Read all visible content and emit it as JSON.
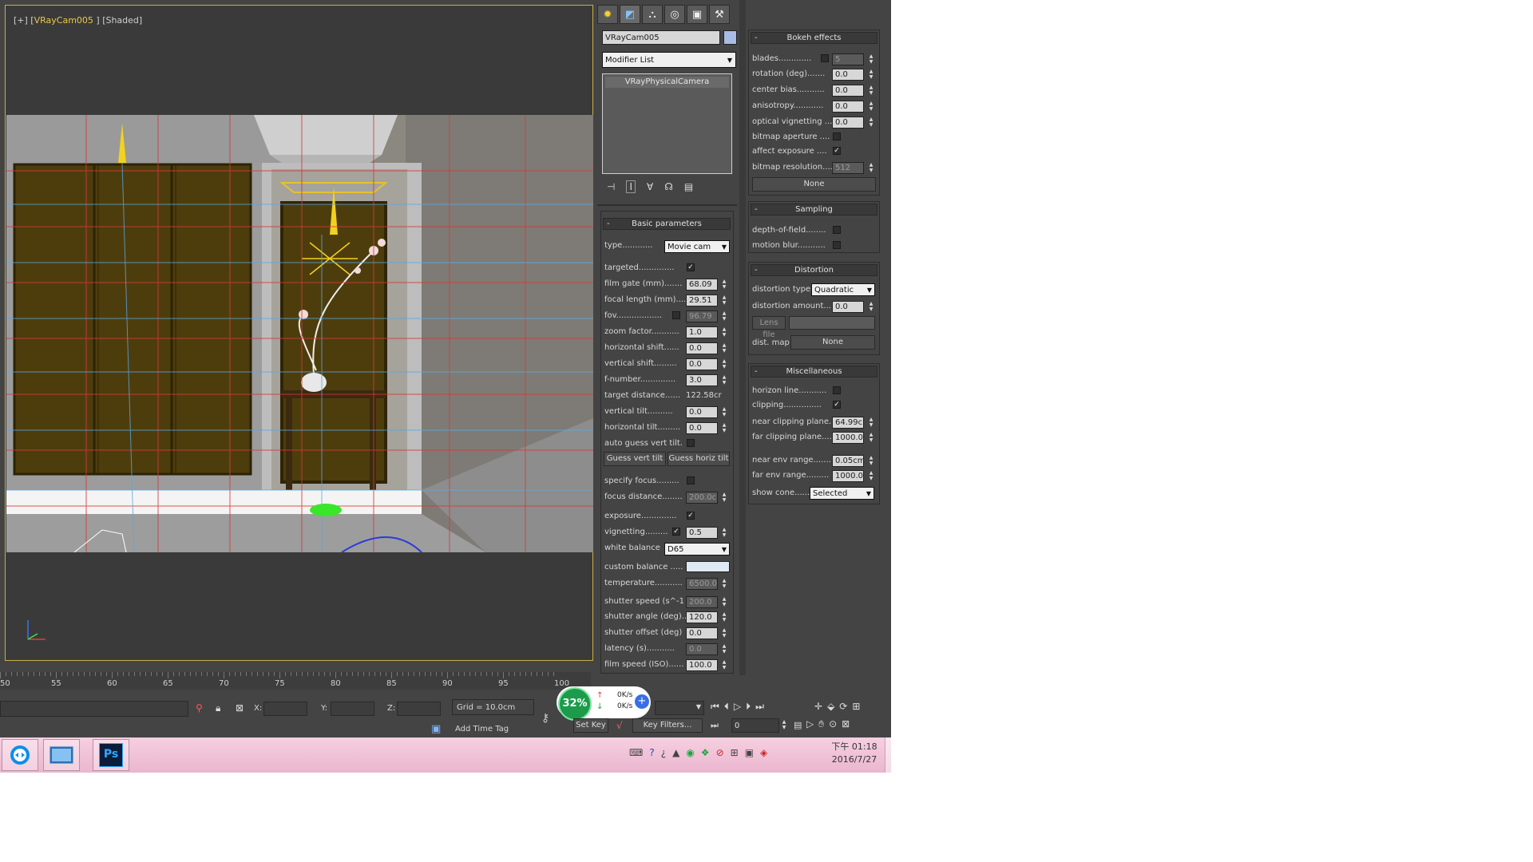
{
  "viewport": {
    "label_prefix": "[+] [",
    "camera": "VRayCam005",
    "label_suffix": " ] [Shaded]"
  },
  "command_panel": {
    "tabs": [
      "create-icon",
      "modify-icon",
      "hierarchy-icon",
      "motion-icon",
      "display-icon",
      "utilities-icon"
    ],
    "object_name": "VRayCam005",
    "object_color": "#a8bce6",
    "modifier_list": "Modifier List",
    "stack_item": "VRayPhysicalCamera"
  },
  "basic": {
    "title": "Basic parameters",
    "type_label": "type............",
    "type_value": "Movie cam",
    "targeted": "targeted..............",
    "film_gate": "film gate (mm).......",
    "film_gate_v": "68.09",
    "focal_length": "focal length (mm)....",
    "focal_length_v": "29.51",
    "fov": "fov..................",
    "fov_v": "96.79",
    "zoom": "zoom factor...........",
    "zoom_v": "1.0",
    "hshift": "horizontal shift......",
    "hshift_v": "0.0",
    "vshift": "vertical shift.........",
    "vshift_v": "0.0",
    "fnumber": "f-number..............",
    "fnumber_v": "3.0",
    "target_distance": "target distance......",
    "target_distance_v": "122.58cr",
    "vtilt": "vertical tilt..........",
    "vtilt_v": "0.0",
    "htilt": "horizontal tilt.........",
    "htilt_v": "0.0",
    "auto_guess": "auto guess vert tilt.",
    "guess_vert": "Guess vert tilt",
    "guess_horiz": "Guess horiz tilt",
    "specify_focus": "specify focus.........",
    "focus_distance": "focus distance........",
    "focus_distance_v": "200.0cr",
    "exposure": "exposure..............",
    "vignetting": "vignetting.........",
    "vignetting_v": "0.5",
    "white_balance": "white balance",
    "white_balance_v": "D65",
    "custom_balance": "custom balance .....",
    "custom_balance_color": "#dfe8f5",
    "temperature": "temperature...........",
    "temperature_v": "6500.0",
    "shutter_speed": "shutter speed (s^-1",
    "shutter_speed_v": "200.0",
    "shutter_angle": "shutter angle (deg)..",
    "shutter_angle_v": "120.0",
    "shutter_offset": "shutter offset (deg)",
    "shutter_offset_v": "0.0",
    "latency": "latency (s)...........",
    "latency_v": "0.0",
    "film_speed": "film speed (ISO)......",
    "film_speed_v": "100.0"
  },
  "bokeh": {
    "title": "Bokeh effects",
    "blades": "blades.............",
    "blades_v": "5",
    "rotation": "rotation (deg).......",
    "rotation_v": "0.0",
    "center_bias": "center bias...........",
    "center_bias_v": "0.0",
    "anisotropy": "anisotropy............",
    "anisotropy_v": "0.0",
    "optical": "optical vignetting ...",
    "optical_v": "0.0",
    "bitmap_aperture": "bitmap aperture ....",
    "affect_exposure": "affect exposure ....",
    "bitmap_res": "bitmap resolution....",
    "bitmap_res_v": "512",
    "none": "None"
  },
  "sampling": {
    "title": "Sampling",
    "dof": "depth-of-field........",
    "motion_blur": "motion blur..........."
  },
  "distortion": {
    "title": "Distortion",
    "type": "distortion type.",
    "type_v": "Quadratic",
    "amount": "distortion amount...",
    "amount_v": "0.0",
    "lens_file": "Lens file",
    "dist_map": "dist. map",
    "none": "None"
  },
  "misc": {
    "title": "Miscellaneous",
    "horizon": "horizon line...........",
    "clipping": "clipping...............",
    "near_clip": "near clipping plane..",
    "near_clip_v": "64.99cr",
    "far_clip": "far clipping plane....",
    "far_clip_v": "1000.0",
    "near_env": "near env range.......",
    "near_env_v": "0.05cm",
    "far_env": "far env range.........",
    "far_env_v": "1000.0",
    "show_cone": "show cone......",
    "show_cone_v": "Selected"
  },
  "timeline": {
    "ticks": [
      "50",
      "55",
      "60",
      "65",
      "70",
      "75",
      "80",
      "85",
      "90",
      "95",
      "100"
    ]
  },
  "status": {
    "x_label": "X:",
    "y_label": "Y:",
    "z_label": "Z:",
    "grid": "Grid = 10.0cm",
    "add_time_tag": "Add Time Tag",
    "set_key": "Set Key",
    "key_filters": "Key Filters...",
    "frame": "0",
    "progress_percent": "32%",
    "net_up": "0K/s",
    "net_down": "0K/s"
  },
  "taskbar": {
    "time": "下午 01:18",
    "date": "2016/7/27",
    "ps_label": "Ps"
  }
}
